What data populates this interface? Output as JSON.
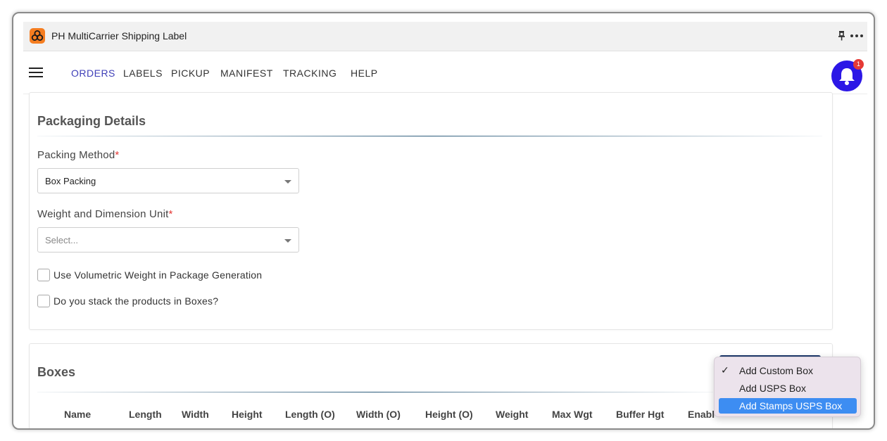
{
  "app": {
    "title": "PH MultiCarrier Shipping Label"
  },
  "icons": {
    "logo": "app-logo-icon",
    "pin": "pin-icon",
    "more": "more-icon",
    "menu": "hamburger-icon",
    "bell": "bell-icon"
  },
  "nav": {
    "items": [
      {
        "label": "ORDERS",
        "active": true
      },
      {
        "label": "LABELS"
      },
      {
        "label": "PICKUP"
      },
      {
        "label": "MANIFEST"
      },
      {
        "label": "TRACKING"
      },
      {
        "label": "HELP"
      }
    ],
    "notification_count": "1"
  },
  "packaging": {
    "title": "Packaging Details",
    "packing_method": {
      "label": "Packing Method",
      "required_mark": "*",
      "value": "Box Packing"
    },
    "unit": {
      "label": "Weight and Dimension Unit",
      "required_mark": "*",
      "placeholder": "Select..."
    },
    "checkboxes": [
      {
        "label": "Use Volumetric Weight in Package Generation",
        "checked": false
      },
      {
        "label": "Do you stack the products in Boxes?",
        "checked": false
      }
    ]
  },
  "boxes": {
    "title": "Boxes",
    "columns": [
      "Name",
      "Length",
      "Width",
      "Height",
      "Length (O)",
      "Width (O)",
      "Height (O)",
      "Weight",
      "Max Wgt",
      "Buffer Hgt",
      "Enabl"
    ]
  },
  "dropdown": {
    "items": [
      {
        "label": "Add Custom Box",
        "checked": true,
        "check_mark": "✓"
      },
      {
        "label": "Add USPS Box",
        "checked": false
      },
      {
        "label": "Add Stamps USPS Box",
        "checked": false,
        "highlighted": true
      }
    ]
  },
  "colors": {
    "accent": "#3f3fb8",
    "bell": "#2c17e6",
    "badge": "#e53935",
    "menu_highlight": "#3d8df2"
  }
}
